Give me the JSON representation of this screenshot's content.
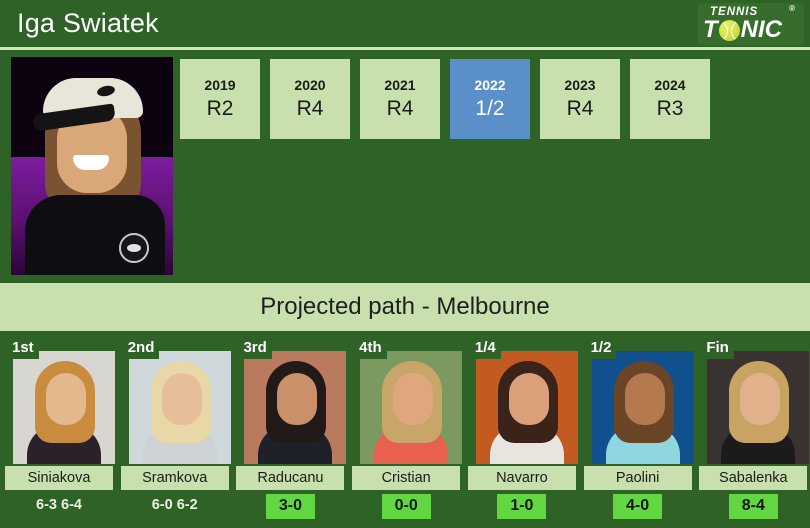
{
  "header": {
    "title": "Iga Swiatek",
    "logo": {
      "top_text": "TENNIS",
      "main_text_before": "T",
      "main_text_after": "NIC",
      "registered_mark": "®",
      "ball_icon": "tennis-ball-icon"
    }
  },
  "hero": {
    "photo_alt": "Iga Swiatek portrait"
  },
  "years": [
    {
      "year": "2019",
      "result": "R2",
      "active": false
    },
    {
      "year": "2020",
      "result": "R4",
      "active": false
    },
    {
      "year": "2021",
      "result": "R4",
      "active": false
    },
    {
      "year": "2022",
      "result": "1/2",
      "active": true
    },
    {
      "year": "2023",
      "result": "R4",
      "active": false
    },
    {
      "year": "2024",
      "result": "R3",
      "active": false
    }
  ],
  "banner": {
    "title": "Projected path - Melbourne"
  },
  "path": [
    {
      "round": "1st",
      "name": "Siniakova",
      "score": "6-3 6-4",
      "badge": false
    },
    {
      "round": "2nd",
      "name": "Sramkova",
      "score": "6-0 6-2",
      "badge": false
    },
    {
      "round": "3rd",
      "name": "Raducanu",
      "score": "3-0",
      "badge": true
    },
    {
      "round": "4th",
      "name": "Cristian",
      "score": "0-0",
      "badge": true
    },
    {
      "round": "1/4",
      "name": "Navarro",
      "score": "1-0",
      "badge": true
    },
    {
      "round": "1/2",
      "name": "Paolini",
      "score": "4-0",
      "badge": true
    },
    {
      "round": "Fin",
      "name": "Sabalenka",
      "score": "8-4",
      "badge": true
    }
  ],
  "colors": {
    "page_green": "#2f6227",
    "light_green": "#c8e0ae",
    "highlight_blue": "#5b8fc9",
    "badge_green": "#63d742"
  }
}
